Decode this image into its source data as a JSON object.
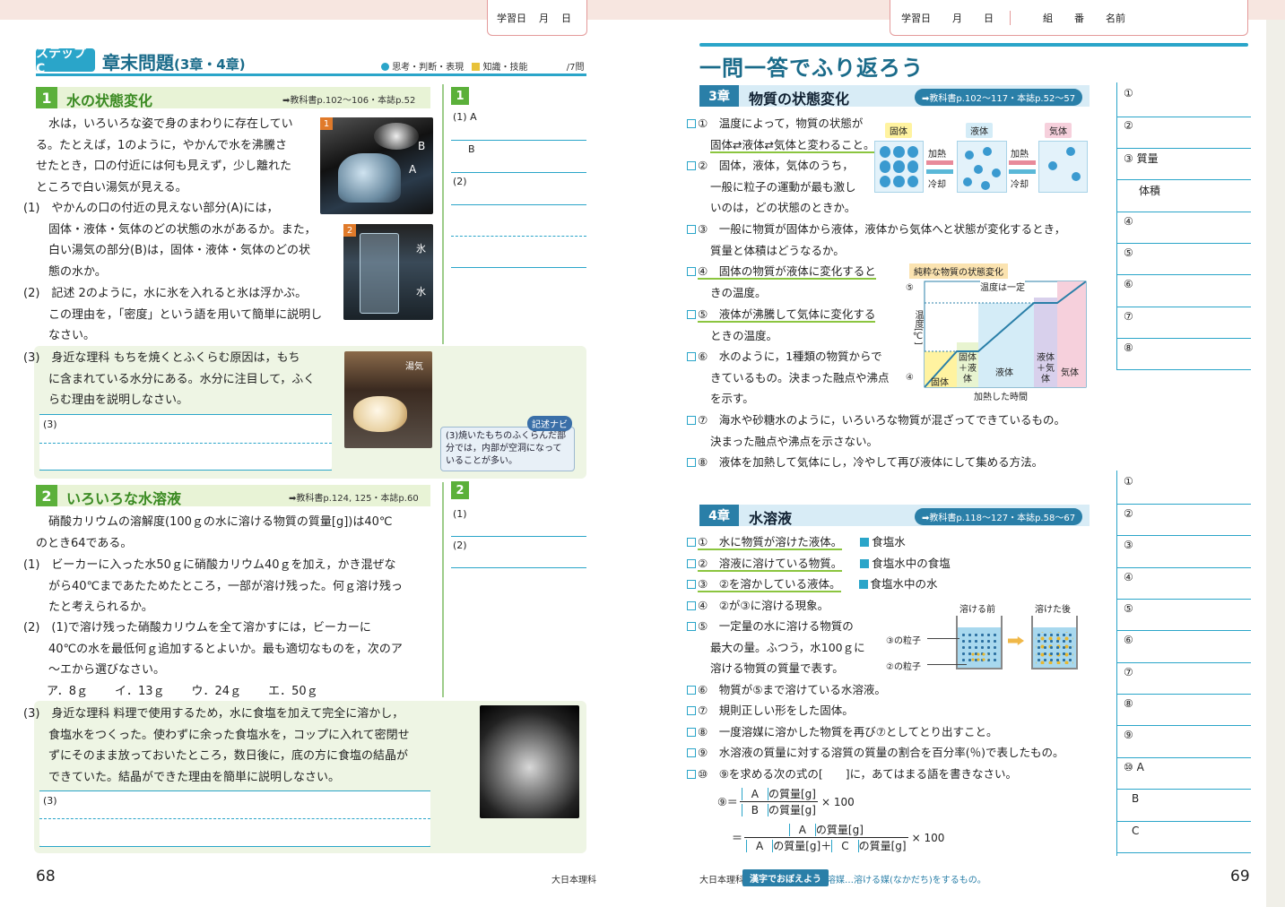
{
  "header": {
    "left_date": [
      "学習日",
      "月",
      "日"
    ],
    "right_date": [
      "学習日",
      "月",
      "日"
    ],
    "right_name": [
      "組",
      "番",
      "名前"
    ]
  },
  "left": {
    "step_label": "ステップC",
    "title": "章末問題",
    "title_sub": "(3章・4章)",
    "legend": [
      "思考・判断・表現",
      "知識・技能",
      "/7問"
    ],
    "sec1": {
      "num": "1",
      "title": "水の状態変化",
      "ref": "➡教科書p.102〜106・本誌p.52",
      "intro": [
        "水は，いろいろな姿で身のまわりに存在してい",
        "る。たとえば，1のように，やかんで水を沸騰さ",
        "せたとき，口の付近には何も見えず，少し離れた",
        "ところで白い湯気が見える。"
      ],
      "q1": [
        "(1)　やかんの口の付近の見えない部分(A)には，",
        "固体・液体・気体のどの状態の水があるか。また，",
        "白い湯気の部分(B)は，固体・液体・気体のどの状",
        "態の水か。"
      ],
      "q2": [
        "(2)　記述 2のように，水に氷を入れると氷は浮かぶ。",
        "この理由を，「密度」という語を用いて簡単に説明し",
        "なさい。"
      ],
      "q3": [
        "(3)　身近な理科 もちを焼くとふくらむ原因は，もち",
        "に含まれている水分にある。水分に注目して，ふく",
        "らむ理由を説明しなさい。"
      ],
      "q3_answer_label": "(3)",
      "photo1_labels": [
        "1",
        "B",
        "A"
      ],
      "photo2_labels": [
        "2",
        "氷",
        "水"
      ],
      "photo3_label": "湯気",
      "hint_title": "記述ナビ",
      "hint": [
        "(3)焼いたもちのふくらんだ部",
        "分では，内部が空洞になって",
        "いることが多い。"
      ]
    },
    "ans1": {
      "num": "1",
      "labels": [
        "(1) A",
        "B",
        "(2)"
      ]
    },
    "sec2": {
      "num": "2",
      "title": "いろいろな水溶液",
      "ref": "➡教科書p.124, 125・本誌p.60",
      "intro": [
        "硝酸カリウムの溶解度(100ｇの水に溶ける物質の質量[g])は40℃",
        "のとき64である。"
      ],
      "q1": [
        "(1)　ビーカーに入った水50ｇに硝酸カリウム40ｇを加え，かき混ぜな",
        "がら40℃まであたためたところ，一部が溶け残った。何ｇ溶け残っ",
        "たと考えられるか。"
      ],
      "q2": [
        "(2)　(1)で溶け残った硝酸カリウムを全て溶かすには，ビーカーに",
        "40℃の水を最低何ｇ追加するとよいか。最も適切なものを，次のア",
        "〜エから選びなさい。"
      ],
      "choices": [
        "ア．8ｇ",
        "イ．13ｇ",
        "ウ．24ｇ",
        "エ．50ｇ"
      ],
      "q3": [
        "(3)　身近な理科 料理で使用するため，水に食塩を加えて完全に溶かし，",
        "食塩水をつくった。使わずに余った食塩水を，コップに入れて密閉せ",
        "ずにそのまま放っておいたところ，数日後に，底の方に食塩の結晶が",
        "できていた。結晶ができた理由を簡単に説明しなさい。"
      ],
      "q3_answer_label": "(3)"
    },
    "ans2": {
      "num": "2",
      "labels": [
        "(1)",
        "(2)"
      ]
    },
    "page_number": "68",
    "footer": "大日本理科"
  },
  "right": {
    "title": "一問一答でふり返ろう",
    "ch3": {
      "num": "3章",
      "title": "物質の状態変化",
      "ref": "➡教科書p.102〜117・本誌p.52〜57",
      "items": [
        "①　温度によって，物質の状態が",
        "固体⇄液体⇄気体と変わること。",
        "②　固体，液体，気体のうち，",
        "一般に粒子の運動が最も激し",
        "いのは，どの状態のときか。",
        "③　一般に物質が固体から液体，液体から気体へと状態が変化するとき，",
        "質量と体積はどうなるか。",
        "④　固体の物質が液体に変化すると",
        "きの温度。",
        "⑤　液体が沸騰して気体に変化する",
        "ときの温度。",
        "⑥　水のように，1種類の物質からで",
        "きているもの。決まった融点や沸点",
        "を示す。",
        "⑦　海水や砂糖水のように，いろいろな物質が混ざってできているもの。",
        "決まった融点や沸点を示さない。",
        "⑧　液体を加熱して気体にし，冷やして再び液体にして集める方法。"
      ],
      "states": [
        "固体",
        "液体",
        "気体"
      ],
      "arrows": [
        "加熱",
        "冷却",
        "加熱",
        "冷却"
      ],
      "graph_title": "純粋な物質の状態変化",
      "graph_labels": {
        "const": "温度は一定",
        "ylabel": "温度[℃]",
        "xlabel": "加熱した時間",
        "m5": "⑤",
        "m4": "④",
        "solid": "固体",
        "sl": "固体＋液体",
        "liquid": "液体",
        "lg": "液体＋気体",
        "gas": "気体"
      }
    },
    "ch3_answers": [
      "①",
      "②",
      "③ 質量",
      "体積",
      "④",
      "⑤",
      "⑥",
      "⑦",
      "⑧"
    ],
    "ch4": {
      "num": "4章",
      "title": "水溶液",
      "ref": "➡教科書p.118〜127・本誌p.58〜67",
      "items": [
        "①　水に物質が溶けた液体。",
        "②　溶液に溶けている物質。",
        "③　②を溶かしている液体。",
        "④　②が③に溶ける現象。",
        "⑤　一定量の水に溶ける物質の",
        "最大の量。ふつう，水100ｇに",
        "溶ける物質の質量で表す。",
        "⑥　物質が⑤まで溶けている水溶液。",
        "⑦　規則正しい形をした固体。",
        "⑧　一度溶媒に溶かした物質を再び⑦としてとり出すこと。",
        "⑨　水溶液の質量に対する溶質の質量の割合を百分率(％)で表したもの。",
        "⑩　⑨を求める次の式の[　　]に，あてはまる語を書きなさい。"
      ],
      "examples": [
        "食塩水",
        "食塩水中の食塩",
        "食塩水中の水"
      ],
      "beaker_labels": [
        "溶ける前",
        "溶けた後",
        "③の粒子",
        "②の粒子"
      ],
      "formula": {
        "lhs": "⑨＝",
        "a": "A",
        "b": "B",
        "c": "C",
        "mass": "の質量[g]",
        "times": "× 100",
        "plus": "＋"
      }
    },
    "ch4_answers": [
      "①",
      "②",
      "③",
      "④",
      "⑤",
      "⑥",
      "⑦",
      "⑧",
      "⑨",
      "⑩ A",
      "B",
      "C"
    ],
    "footer_brand": "大日本理科",
    "footer_kanji_label": "漢字でおぼえよう",
    "footer_kanji": "溶媒…溶ける媒(なかだち)をするもの。",
    "page_number": "69"
  }
}
